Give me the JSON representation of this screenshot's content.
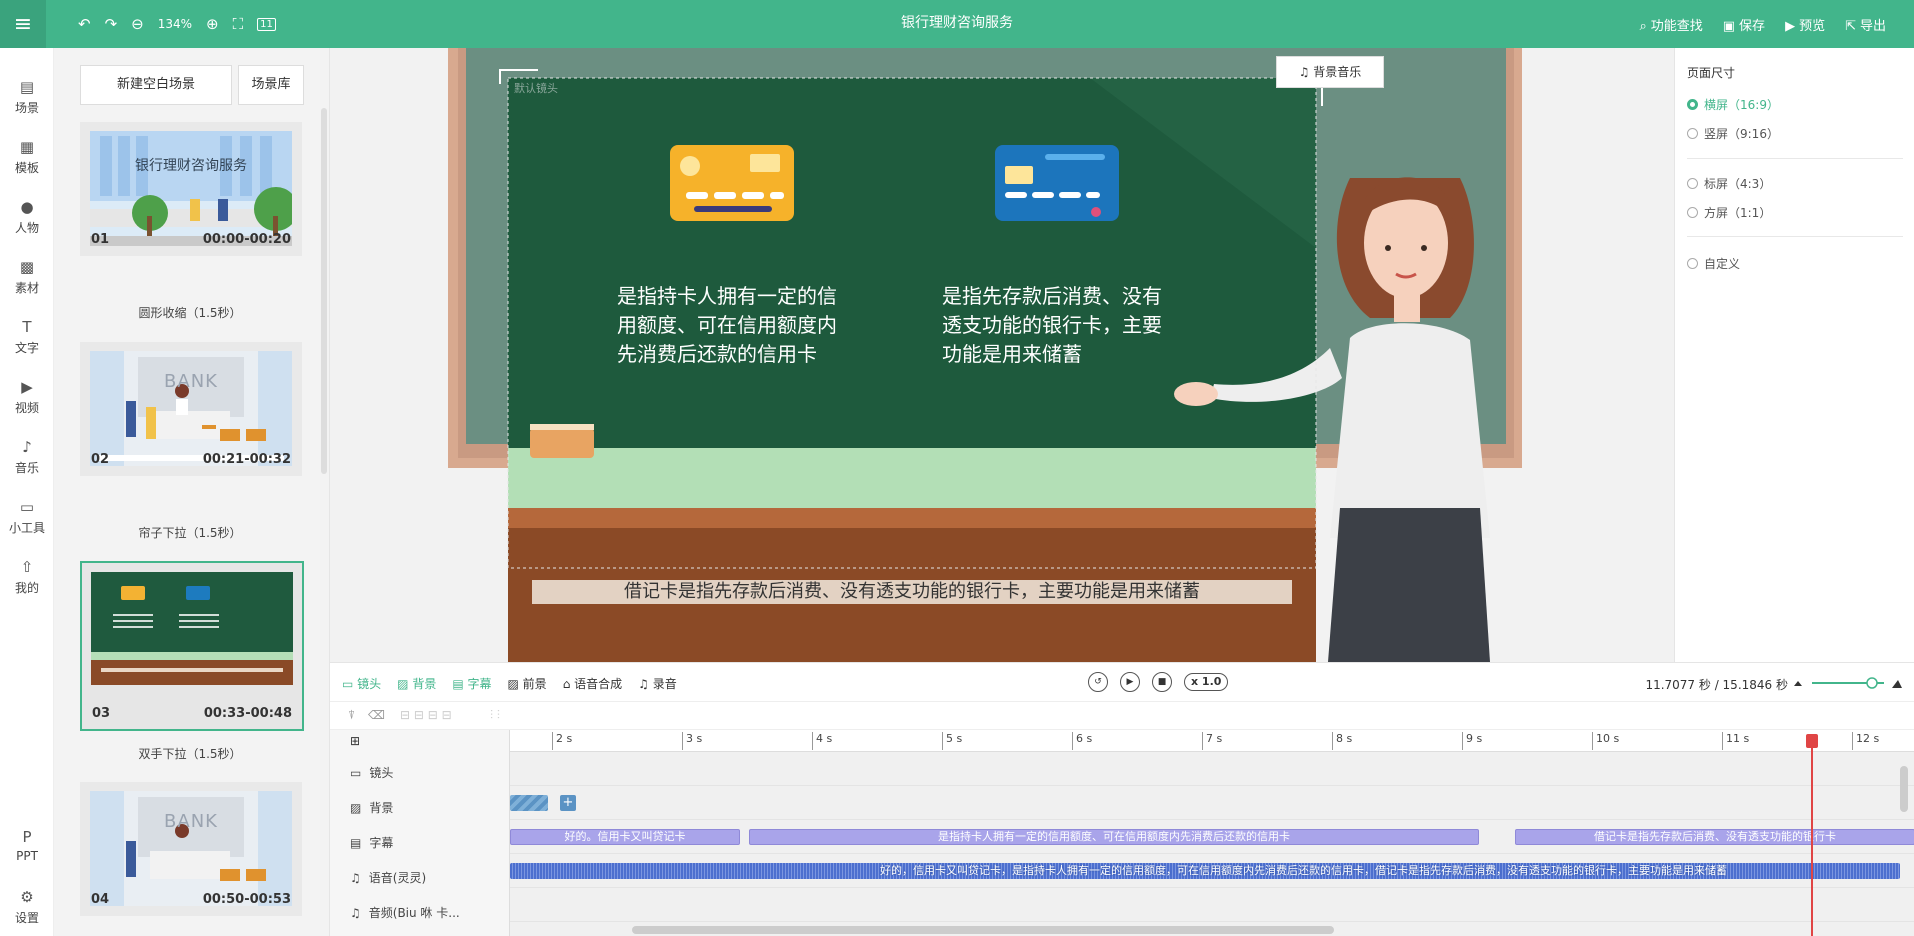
{
  "app": {
    "title": "银行理财咨询服务",
    "accent": "#42b58b"
  },
  "toolbar": {
    "zoom": "134%",
    "zoom_extra": "11"
  },
  "topright": {
    "search": "功能查找",
    "save": "保存",
    "preview": "预览",
    "export": "导出"
  },
  "sidebar": {
    "items": [
      {
        "label": "场景",
        "icon": "file-icon"
      },
      {
        "label": "模板",
        "icon": "template-icon"
      },
      {
        "label": "人物",
        "icon": "person-icon"
      },
      {
        "label": "素材",
        "icon": "material-icon"
      },
      {
        "label": "文字",
        "icon": "text-icon"
      },
      {
        "label": "视频",
        "icon": "video-icon"
      },
      {
        "label": "音乐",
        "icon": "music-icon"
      },
      {
        "label": "小工具",
        "icon": "toolbox-icon"
      },
      {
        "label": "我的",
        "icon": "upload-icon"
      }
    ],
    "bottom": [
      {
        "label": "PPT",
        "icon": "ppt-icon"
      },
      {
        "label": "设置",
        "icon": "settings-icon"
      }
    ]
  },
  "scenes": {
    "new_blank": "新建空白场景",
    "library": "场景库",
    "list": [
      {
        "num": "01",
        "time": "00:00-00:20",
        "thumb_title": "银行理财咨询服务",
        "transition": "圆形收缩（1.5秒）"
      },
      {
        "num": "02",
        "time": "00:21-00:32",
        "thumb_title": "BANK",
        "transition": "帘子下拉（1.5秒）"
      },
      {
        "num": "03",
        "time": "00:33-00:48",
        "thumb_title": "",
        "transition": "双手下拉（1.5秒）"
      },
      {
        "num": "04",
        "time": "00:50-00:53",
        "thumb_title": "BANK",
        "transition": ""
      }
    ]
  },
  "canvas": {
    "camera_label": "默认镜头",
    "bg_music": "背景音乐",
    "text_left": "是指持卡人拥有一定的信用额度、可在信用额度内先消费后还款的信用卡",
    "text_right": "是指先存款后消费、没有透支功能的银行卡，主要功能是用来储蓄",
    "subtitle": "借记卡是指先存款后消费、没有透支功能的银行卡，主要功能是用来储蓄"
  },
  "page_size": {
    "title": "页面尺寸",
    "options": [
      {
        "label": "横屏（16:9）",
        "selected": true
      },
      {
        "label": "竖屏（9:16）",
        "selected": false
      },
      {
        "label": "标屏（4:3）",
        "selected": false
      },
      {
        "label": "方屏（1:1）",
        "selected": false
      },
      {
        "label": "自定义",
        "selected": false
      }
    ]
  },
  "timeline": {
    "tabs": [
      "镜头",
      "背景",
      "字幕",
      "前景",
      "语音合成",
      "录音"
    ],
    "speed": "x 1.0",
    "time": "11.7077 秒 / 15.1846 秒",
    "ticks": [
      "2 s",
      "3 s",
      "4 s",
      "5 s",
      "6 s",
      "7 s",
      "8 s",
      "9 s",
      "10 s",
      "11 s",
      "12 s"
    ],
    "tracks": [
      "镜头",
      "背景",
      "字幕",
      "语音(灵灵)",
      "音频(Biu 咻 卡..."
    ],
    "subtitle_clips": [
      "好的。信用卡又叫贷记卡",
      "是指持卡人拥有一定的信用额度、可在信用额度内先消费后还款的信用卡",
      "借记卡是指先存款后消费、没有透支功能的银行卡"
    ],
    "voice_text": "好的，信用卡又叫贷记卡，是指持卡人拥有一定的信用额度，可在信用额度内先消费后还款的信用卡，借记卡是指先存款后消费，没有透支功能的银行卡，主要功能是用来储蓄"
  }
}
